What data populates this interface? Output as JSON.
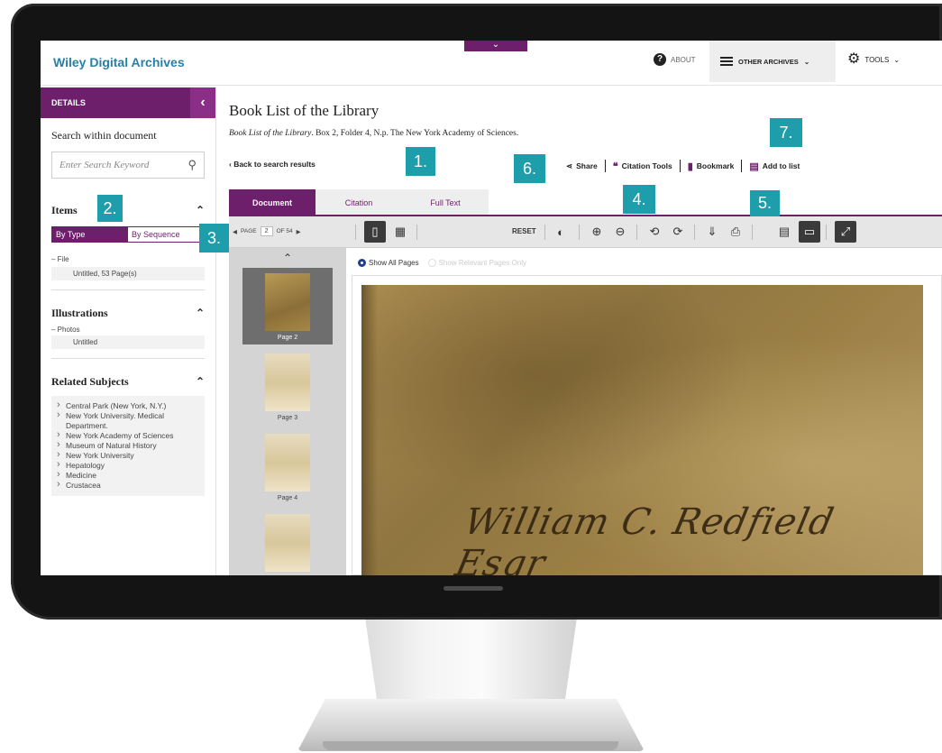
{
  "app": {
    "brand": "Wiley Digital Archives",
    "about_label": "ABOUT",
    "other_archives_label": "OTHER ARCHIVES",
    "tools_label": "TOOLS"
  },
  "sidebar": {
    "header": "DETAILS",
    "search_title": "Search within document",
    "search_placeholder": "Enter Search Keyword",
    "items_heading": "Items",
    "seg_by_type": "By Type",
    "seg_by_sequence": "By Sequence",
    "file_label": "– File",
    "file_item": "Untitled, 53 Page(s)",
    "illustrations_heading": "Illustrations",
    "photos_label": "– Photos",
    "photos_item": "Untitled",
    "related_heading": "Related Subjects",
    "subjects": [
      "Central Park (New York, N.Y.)",
      "New York University. Medical Department.",
      "New York Academy of Sciences",
      "Museum of Natural History",
      "New York University",
      "Hepatology",
      "Medicine",
      "Crustacea"
    ]
  },
  "main": {
    "title": "Book List of the Library",
    "citation_italic": "Book List of the Library",
    "citation_rest": ". Box 2, Folder 4, N.p. The New York Academy of Sciences.",
    "back_link": "‹ Back to search results",
    "actions": {
      "share": "Share",
      "citation_tools": "Citation Tools",
      "bookmark": "Bookmark",
      "add_to_list": "Add to list"
    },
    "tabs": [
      "Document",
      "Citation",
      "Full Text"
    ],
    "pager": {
      "page_label": "PAGE",
      "page_value": "2",
      "of_label": "OF 54"
    },
    "reset_label": "RESET",
    "radio_all": "Show All Pages",
    "radio_relevant": "Show Relevant Pages Only",
    "thumbs": [
      "Page 2",
      "Page 3",
      "Page 4"
    ],
    "script_text": "William C. Redfield Esqr"
  },
  "callouts": [
    "1.",
    "2.",
    "3.",
    "4.",
    "5.",
    "6.",
    "7."
  ],
  "colors": {
    "brand_purple": "#6e1f6c",
    "link_blue": "#2a7fa6",
    "callout_teal": "#1d9eaa"
  }
}
